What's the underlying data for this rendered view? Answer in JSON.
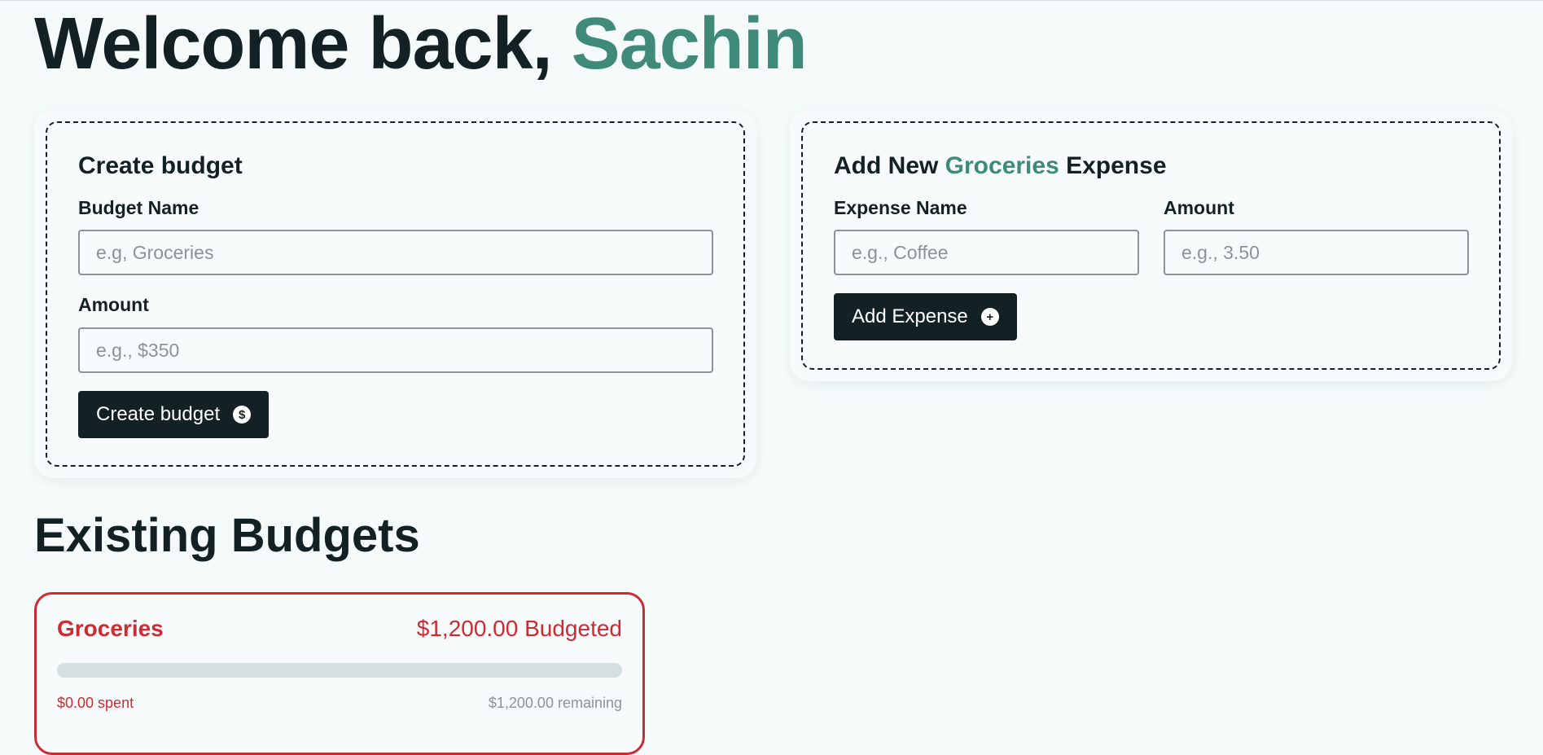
{
  "header": {
    "greeting_prefix": "Welcome back, ",
    "user_name": "Sachin"
  },
  "create_budget": {
    "title": "Create budget",
    "name_label": "Budget Name",
    "name_placeholder": "e.g, Groceries",
    "name_value": "",
    "amount_label": "Amount",
    "amount_placeholder": "e.g., $350",
    "amount_value": "",
    "submit_label": "Create budget",
    "submit_icon": "dollar-circle-icon"
  },
  "add_expense": {
    "title_prefix": "Add New ",
    "budget_name": "Groceries",
    "title_suffix": " Expense",
    "name_label": "Expense Name",
    "name_placeholder": "e.g., Coffee",
    "name_value": "",
    "amount_label": "Amount",
    "amount_placeholder": "e.g., 3.50",
    "amount_value": "",
    "submit_label": "Add Expense",
    "submit_icon": "plus-circle-icon"
  },
  "existing_budgets": {
    "title": "Existing Budgets",
    "items": [
      {
        "name": "Groceries",
        "budgeted": "$1,200.00 Budgeted",
        "spent": "$0.00 spent",
        "remaining": "$1,200.00 remaining",
        "progress_fraction": 0
      }
    ]
  },
  "colors": {
    "accent": "#3f8a79",
    "dark": "#142124",
    "danger": "#cc2b31",
    "muted": "#8a9396",
    "background": "#f5fafb"
  }
}
